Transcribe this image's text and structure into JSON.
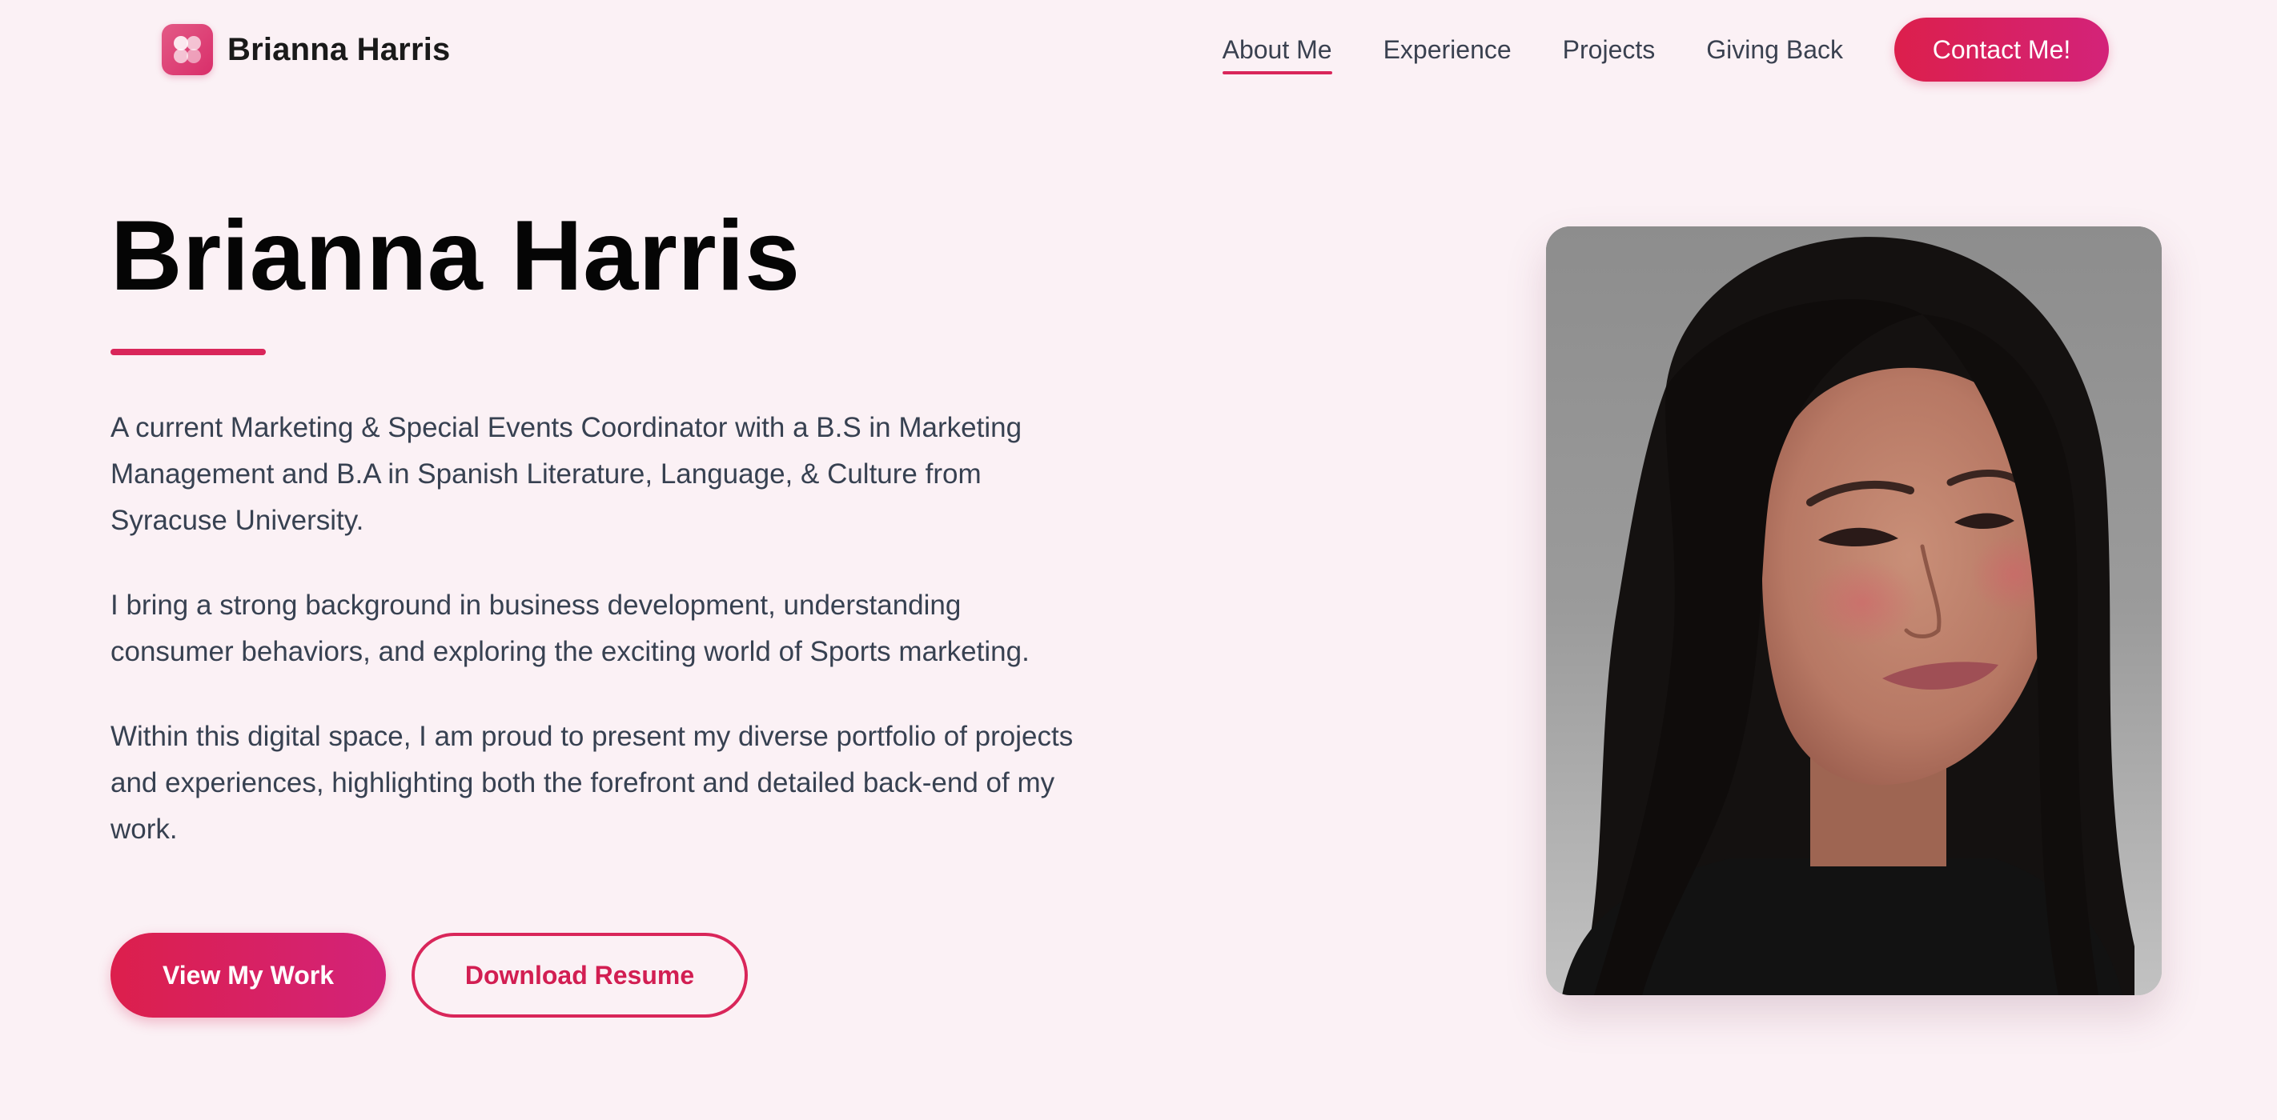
{
  "header": {
    "brand_name": "Brianna Harris",
    "logo_icon": "flower-logo-icon",
    "nav": [
      {
        "label": "About Me",
        "active": true
      },
      {
        "label": "Experience",
        "active": false
      },
      {
        "label": "Projects",
        "active": false
      },
      {
        "label": "Giving Back",
        "active": false
      }
    ],
    "contact_label": "Contact Me!"
  },
  "hero": {
    "title": "Brianna Harris",
    "paragraphs": [
      "A current Marketing & Special Events Coordinator with a B.S in Marketing Management and B.A in Spanish Literature, Language, & Culture from Syracuse University.",
      "I bring a strong background in business development, understanding consumer behaviors, and exploring the exciting world of Sports marketing.",
      "Within this digital space, I am proud to present my diverse portfolio of projects and experiences, highlighting both the forefront and detailed back-end of my work."
    ],
    "primary_button": "View My Work",
    "secondary_button": "Download Resume"
  },
  "colors": {
    "accent": "#d9265a",
    "accent_gradient_end": "#d32379",
    "background": "#fbf1f5",
    "heading": "#050505",
    "body_text": "#374151"
  }
}
